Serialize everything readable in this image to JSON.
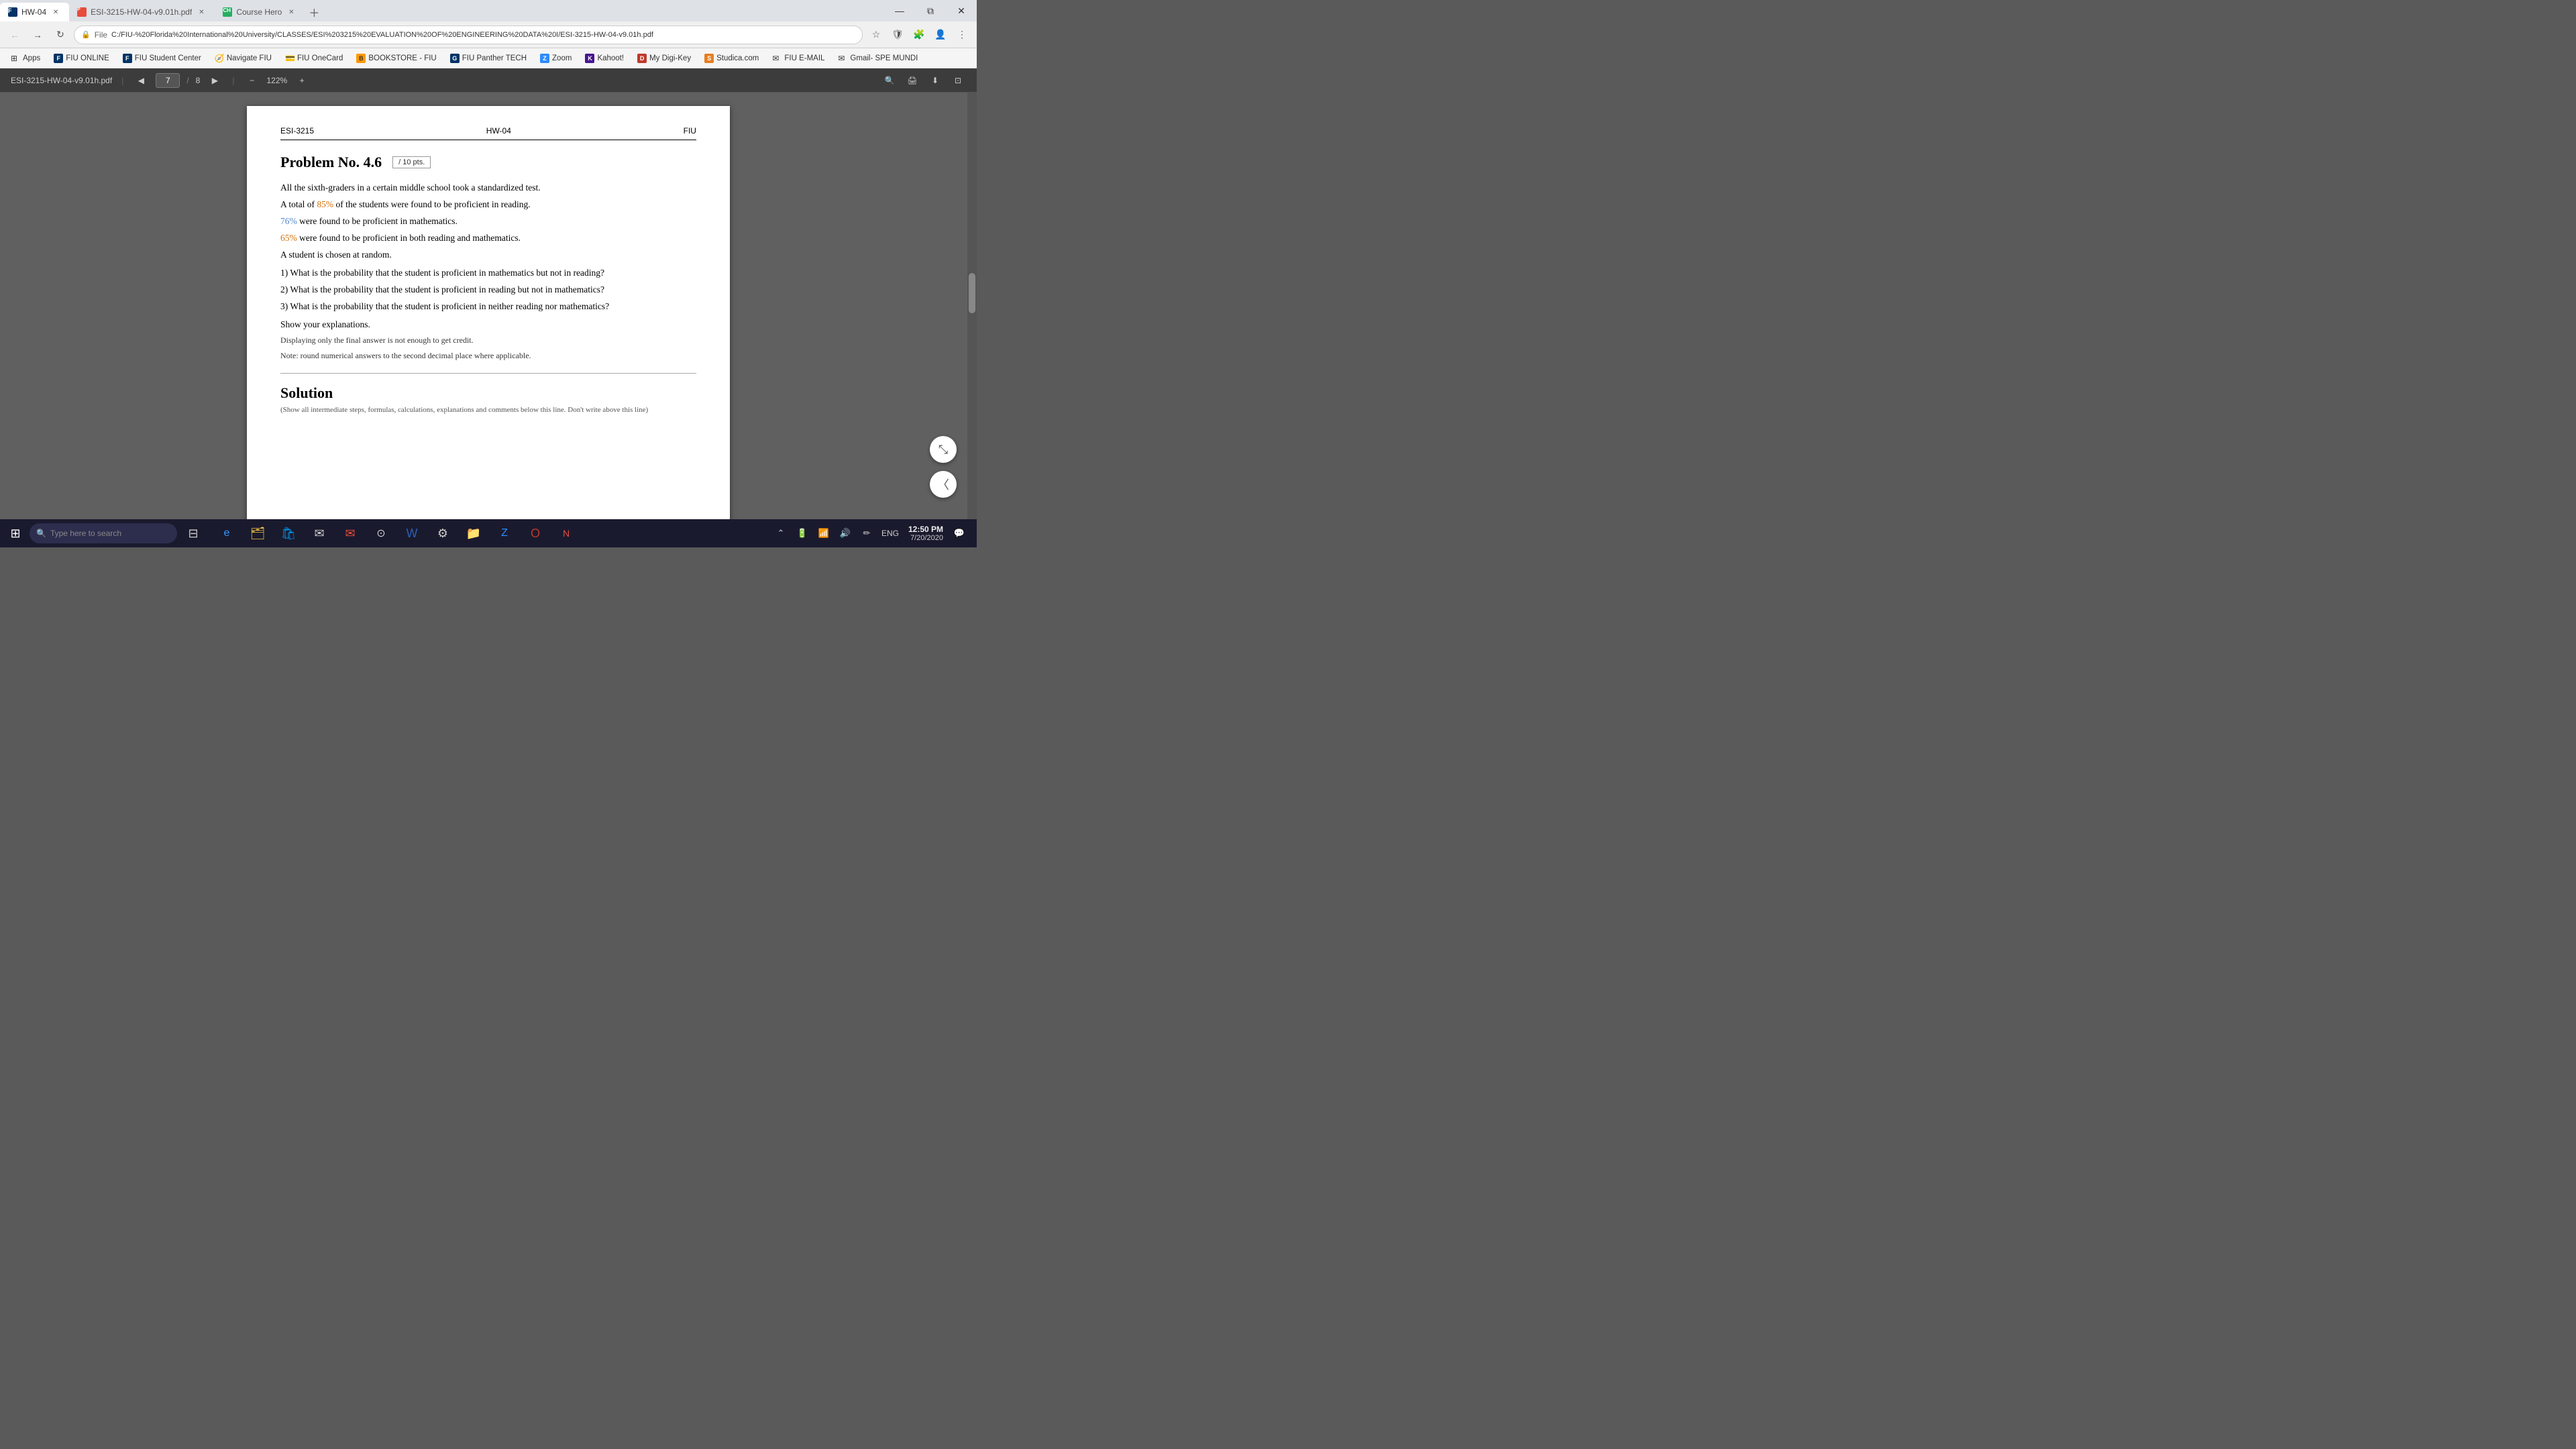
{
  "browser": {
    "tabs": [
      {
        "id": "tab1",
        "favicon_label": "FIU",
        "favicon_bg": "#003366",
        "title": "HW-04",
        "active": true
      },
      {
        "id": "tab2",
        "favicon_label": "PDF",
        "favicon_bg": "#e74c3c",
        "title": "ESI-3215-HW-04-v9.01h.pdf",
        "active": false
      },
      {
        "id": "tab3",
        "favicon_label": "CH",
        "favicon_bg": "#27ae60",
        "title": "Course Hero",
        "active": false
      }
    ],
    "address_bar": {
      "lock_icon": "🔒",
      "file_label": "File",
      "url": "C:/FIU-%20Florida%20International%20University/CLASSES/ESI%203215%20EVALUATION%20OF%20ENGINEERING%20DATA%20I/ESI-3215-HW-04-v9.01h.pdf"
    },
    "bookmarks": [
      {
        "label": "Apps",
        "favicon": "grid"
      },
      {
        "label": "FIU ONLINE",
        "favicon": "fiu"
      },
      {
        "label": "FIU Student Center",
        "favicon": "fiu"
      },
      {
        "label": "Navigate FIU",
        "favicon": "nav"
      },
      {
        "label": "FIU OneCard",
        "favicon": "card"
      },
      {
        "label": "BOOKSTORE - FIU",
        "favicon": "book"
      },
      {
        "label": "FIU Panther TECH",
        "favicon": "tech"
      },
      {
        "label": "Zoom",
        "favicon": "zoom"
      },
      {
        "label": "Kahoot!",
        "favicon": "kahoot"
      },
      {
        "label": "My Digi-Key",
        "favicon": "key"
      },
      {
        "label": "Studica.com",
        "favicon": "studica"
      },
      {
        "label": "FIU E-MAIL",
        "favicon": "email"
      },
      {
        "label": "Gmail- SPE MUNDI",
        "favicon": "gmail"
      }
    ]
  },
  "pdf_toolbar": {
    "filename": "ESI-3215-HW-04-v9.01h.pdf",
    "page_current": "7",
    "page_total": "8",
    "zoom": "122%"
  },
  "pdf_content": {
    "header": {
      "left": "ESI-3215",
      "center": "HW-04",
      "right": "FIU"
    },
    "problem": {
      "title": "Problem No. 4.6",
      "points_label": "/ 10 pts.",
      "intro": "All the sixth-graders in a certain middle school took a standardized test.",
      "line1": "A total of ",
      "pct1": "85%",
      "line1b": " of the students were found to be proficient in reading.",
      "pct2": "76%",
      "line2": " were found to be proficient in mathematics.",
      "pct3": "65%",
      "line3": " were found to be proficient in both reading and mathematics.",
      "line4": "A student is chosen at random.",
      "q1": "1) What is the probability that the student is proficient in mathematics but not in reading?",
      "q2": "2) What is the probability that the student is proficient in reading but not in mathematics?",
      "q3": "3) What is the probability that the student is proficient in neither reading nor mathematics?",
      "show_exp": "Show your explanations.",
      "note1": "Displaying only the final answer is not enough to get credit.",
      "note2": "Note: round numerical answers to the second decimal place where applicable."
    },
    "solution": {
      "title": "Solution",
      "subtitle": "(Show all intermediate steps, formulas, calculations, explanations and comments below this line. Don't write above this line)"
    }
  },
  "taskbar": {
    "search_placeholder": "Type here to search",
    "clock": {
      "time": "12:50 PM",
      "date": "7/20/2020"
    },
    "language": "ENG"
  }
}
